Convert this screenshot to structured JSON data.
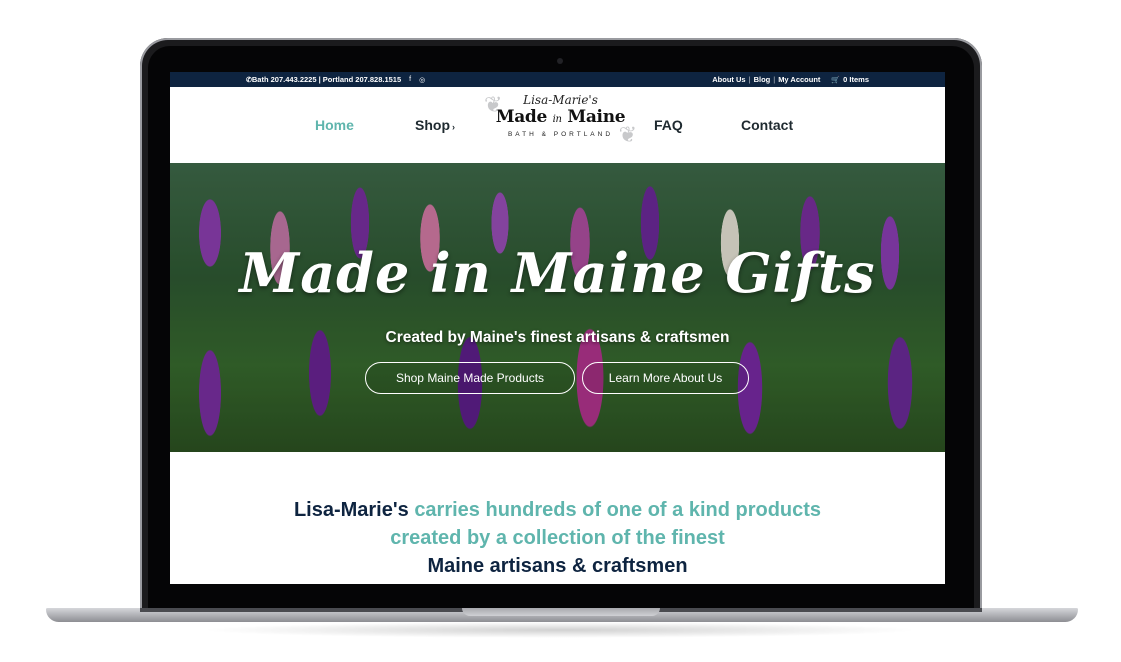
{
  "topbar": {
    "phone": "Bath 207.443.2225 | Portland 207.828.1515",
    "facebook_icon": "f",
    "instagram_icon": "◎",
    "links": [
      "About Us",
      "Blog",
      "My Account"
    ],
    "separator": "|",
    "cart_label": "0 Items"
  },
  "nav": {
    "home": "Home",
    "shop": "Shop",
    "faq": "FAQ",
    "contact": "Contact"
  },
  "logo": {
    "script": "Lisa-Marie's",
    "main_left": "Made",
    "main_in": "in",
    "main_right": "Maine",
    "sub": "BATH & PORTLAND"
  },
  "hero": {
    "title": "Made in Maine Gifts",
    "subtitle": "Created by Maine's finest artisans & craftsmen",
    "btn_shop": "Shop Maine Made Products",
    "btn_learn": "Learn More About Us"
  },
  "intro": {
    "line1_a": "Lisa-Marie's",
    "line1_b": "carries hundreds of one of a kind products",
    "line2": "created by a collection of the finest",
    "line3": "Maine artisans & craftsmen"
  },
  "colors": {
    "navy": "#0e2440",
    "teal": "#5fb5ad",
    "laptop_frame": "#1b1b1d"
  }
}
